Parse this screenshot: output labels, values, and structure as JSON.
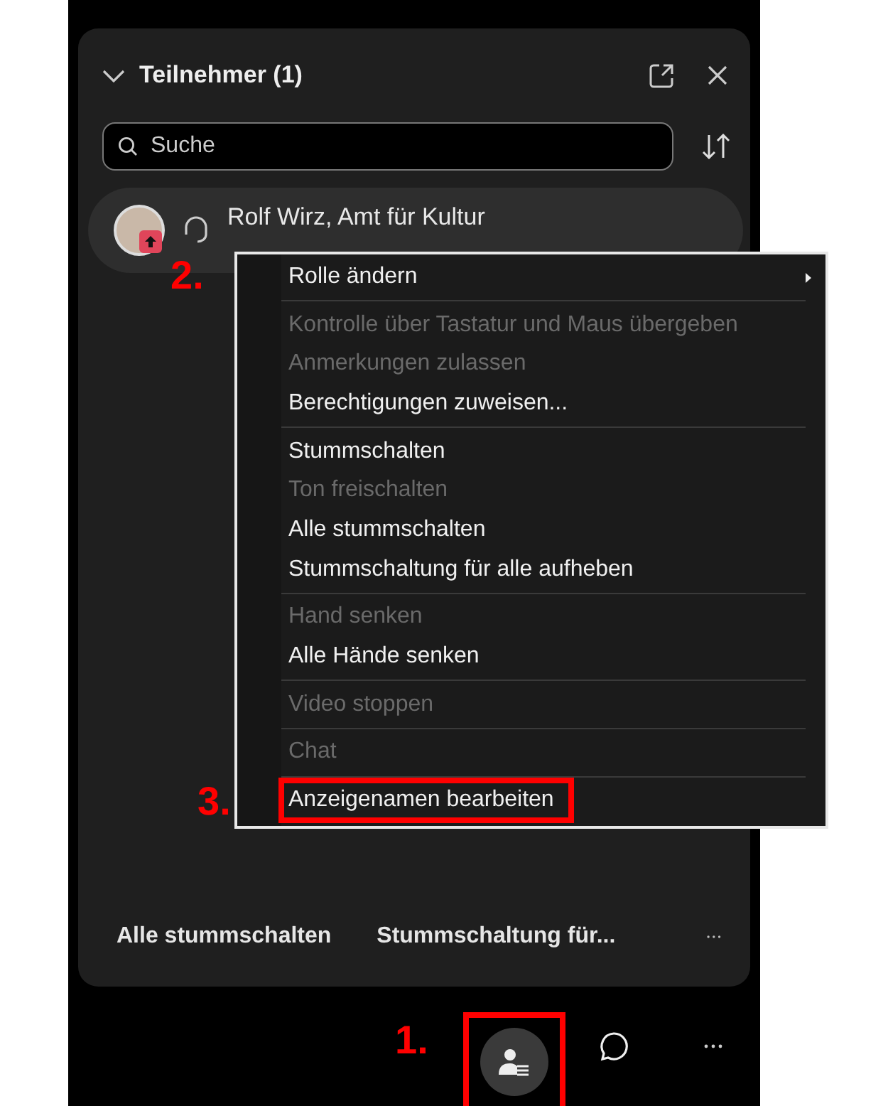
{
  "panel": {
    "title": "Teilnehmer (1)",
    "search": {
      "placeholder": "Suche"
    },
    "participants": [
      {
        "name": "Rolf Wirz, Amt für Kultur",
        "sharing": true,
        "annotation": "2."
      }
    ],
    "footer_buttons": [
      "Alle stummschalten",
      "Stummschaltung für..."
    ]
  },
  "context_menu": {
    "items": [
      {
        "kind": "item",
        "label": "Rolle ändern",
        "disabled": false,
        "submenu": true
      },
      {
        "kind": "separator"
      },
      {
        "kind": "item",
        "label": "Kontrolle über Tastatur und Maus übergeben",
        "disabled": true,
        "submenu": false
      },
      {
        "kind": "item",
        "label": "Anmerkungen zulassen",
        "disabled": true,
        "submenu": false
      },
      {
        "kind": "item",
        "label": "Berechtigungen zuweisen...",
        "disabled": false,
        "submenu": false
      },
      {
        "kind": "separator"
      },
      {
        "kind": "item",
        "label": "Stummschalten",
        "disabled": false,
        "submenu": false
      },
      {
        "kind": "item",
        "label": "Ton freischalten",
        "disabled": true,
        "submenu": false
      },
      {
        "kind": "item",
        "label": "Alle stummschalten",
        "disabled": false,
        "submenu": false
      },
      {
        "kind": "item",
        "label": "Stummschaltung für alle aufheben",
        "disabled": false,
        "submenu": false
      },
      {
        "kind": "separator"
      },
      {
        "kind": "item",
        "label": "Hand senken",
        "disabled": true,
        "submenu": false
      },
      {
        "kind": "item",
        "label": "Alle Hände senken",
        "disabled": false,
        "submenu": false
      },
      {
        "kind": "separator"
      },
      {
        "kind": "item",
        "label": "Video stoppen",
        "disabled": true,
        "submenu": false
      },
      {
        "kind": "separator"
      },
      {
        "kind": "item",
        "label": "Chat",
        "disabled": true,
        "submenu": false
      },
      {
        "kind": "separator"
      },
      {
        "kind": "item",
        "label": "Anzeigenamen bearbeiten",
        "disabled": false,
        "submenu": false,
        "annotation": "3."
      }
    ]
  },
  "toolbar": {
    "buttons": [
      {
        "kind": "participants",
        "selected": true,
        "annotation": "1."
      },
      {
        "kind": "chat",
        "selected": false
      },
      {
        "kind": "more",
        "selected": false
      }
    ]
  }
}
